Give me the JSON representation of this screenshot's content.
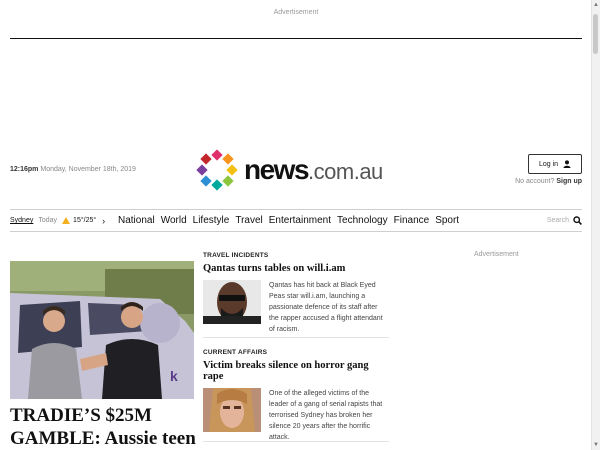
{
  "advertisement": {
    "top_label": "Advertisement",
    "side_label": "Advertisement"
  },
  "header": {
    "time": "12:16pm",
    "date": "Monday, November 18th, 2019",
    "logo": {
      "main": "news",
      "suffix": ".com.au"
    },
    "login_label": "Log in",
    "no_account": "No account?",
    "signup_label": "Sign up"
  },
  "nav": {
    "city": "Sydney",
    "today_label": "Today",
    "temp": "15°/25°",
    "items": [
      "National",
      "World",
      "Lifestyle",
      "Travel",
      "Entertainment",
      "Technology",
      "Finance",
      "Sport"
    ],
    "search_label": "Search"
  },
  "hero": {
    "title": "TRADIE’S $25M GAMBLE: Aussie teen"
  },
  "articles": [
    {
      "kicker": "TRAVEL INCIDENTS",
      "headline": "Qantas turns tables on will.i.am",
      "summary": "Qantas has hit back at Black Eyed Peas star will.i.am, launching a passionate defence of its staff after the rapper accused a flight attendant of racism."
    },
    {
      "kicker": "CURRENT AFFAIRS",
      "headline": "Victim breaks silence on horror gang rape",
      "summary": "One of the alleged victims of the leader of a gang of serial rapists that terrorised Sydney has broken her silence 20 years after the horrific attack."
    }
  ],
  "colors": {
    "logo_dots": [
      "#e0306c",
      "#f7941d",
      "#f2c00f",
      "#8cc63f",
      "#00a99d",
      "#2e8fd3",
      "#7b3fa0",
      "#c1272d"
    ],
    "weather_icon": "#f2b01e"
  }
}
